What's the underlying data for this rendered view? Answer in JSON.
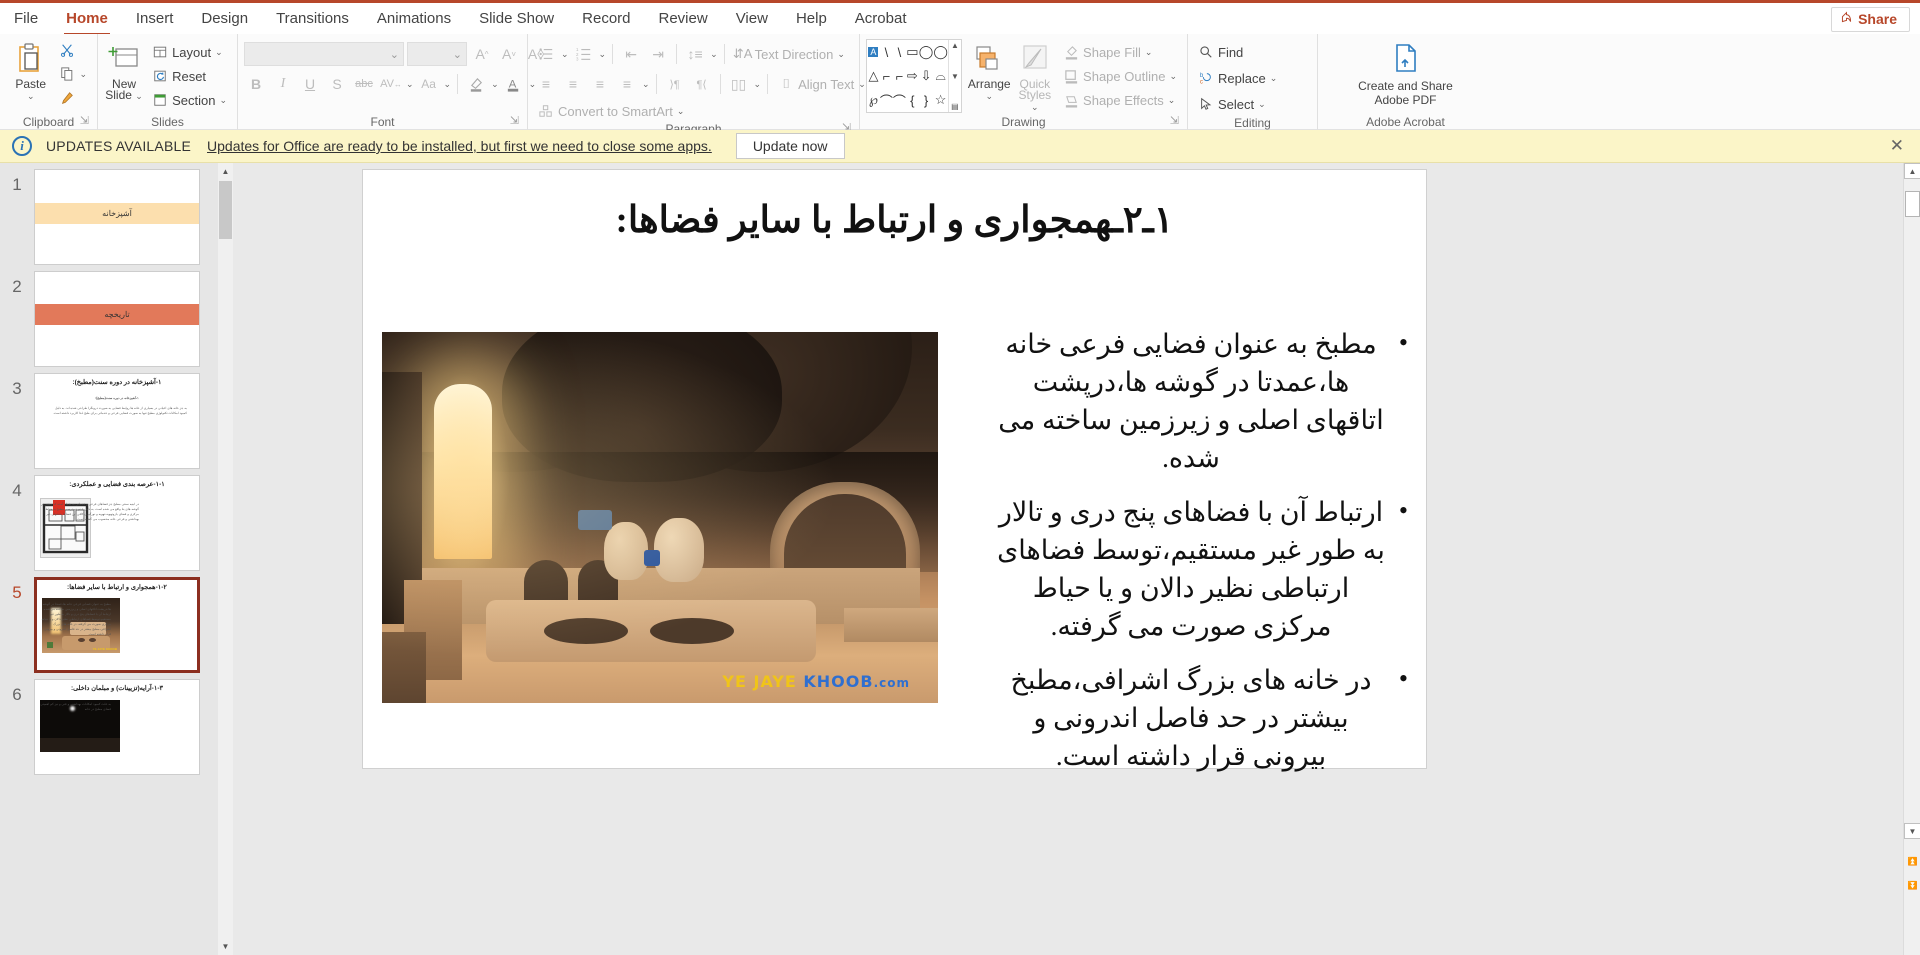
{
  "theme": {
    "accent": "#b7472a",
    "notif_bg": "#fbf5c8",
    "selected_border": "#8c2f20"
  },
  "tabs": [
    {
      "label": "File",
      "active": false
    },
    {
      "label": "Home",
      "active": true
    },
    {
      "label": "Insert",
      "active": false
    },
    {
      "label": "Design",
      "active": false
    },
    {
      "label": "Transitions",
      "active": false
    },
    {
      "label": "Animations",
      "active": false
    },
    {
      "label": "Slide Show",
      "active": false
    },
    {
      "label": "Record",
      "active": false
    },
    {
      "label": "Review",
      "active": false
    },
    {
      "label": "View",
      "active": false
    },
    {
      "label": "Help",
      "active": false
    },
    {
      "label": "Acrobat",
      "active": false
    }
  ],
  "share": {
    "label": "Share"
  },
  "ribbon": {
    "groups": [
      {
        "label": "Clipboard"
      },
      {
        "label": "Slides"
      },
      {
        "label": "Font"
      },
      {
        "label": "Paragraph"
      },
      {
        "label": "Drawing"
      },
      {
        "label": "Editing"
      },
      {
        "label": "Adobe Acrobat"
      }
    ],
    "clipboard": {
      "paste": "Paste",
      "cut": "cut-icon",
      "copy": "copy-icon",
      "format_painter": "format-painter-icon"
    },
    "slides": {
      "new_slide": "New\nSlide",
      "new_slide_line1": "New",
      "new_slide_line2": "Slide",
      "layout": "Layout",
      "reset": "Reset",
      "section": "Section"
    },
    "font": {
      "font_name_value": "",
      "font_size_value": "",
      "grow": "A",
      "shrink": "A",
      "clear_formatting": "clear-formatting-icon",
      "bold": "B",
      "italic": "I",
      "underline": "U",
      "shadow": "S",
      "strikethrough": "abc",
      "char_spacing": "AV",
      "change_case": "Aa",
      "highlight": "text-highlight-icon",
      "font_color": "A"
    },
    "paragraph": {
      "bullets": "bullets-icon",
      "numbering": "numbering-icon",
      "decrease_indent": "decrease-indent-icon",
      "increase_indent": "increase-indent-icon",
      "line_spacing": "line-spacing-icon",
      "align_left": "align-left-icon",
      "align_center": "align-center-icon",
      "align_right": "align-right-icon",
      "justify": "justify-icon",
      "rtl": "rtl-icon",
      "ltr": "ltr-icon",
      "columns": "columns-icon",
      "text_direction": "Text Direction",
      "align_text": "Align Text",
      "convert_to_smartart": "Convert to SmartArt"
    },
    "drawing": {
      "shapes_row1": [
        "A",
        "\\",
        "\\",
        "▭",
        "◯",
        "◯"
      ],
      "shapes_row2": [
        "△",
        "⌐",
        "⌐",
        "⇨",
        "⇩",
        "⌓"
      ],
      "shapes_row3": [
        "℘",
        "⌒",
        "⌒",
        "{",
        "}",
        "☆"
      ],
      "arrange": "Arrange",
      "quick_styles_line1": "Quick",
      "quick_styles_line2": "Styles",
      "shape_fill": "Shape Fill",
      "shape_outline": "Shape Outline",
      "shape_effects": "Shape Effects"
    },
    "editing": {
      "find": "Find",
      "replace": "Replace",
      "select": "Select"
    },
    "acrobat": {
      "create_share_line1": "Create and Share",
      "create_share_line2": "Adobe PDF"
    }
  },
  "notification": {
    "icon": "info-icon",
    "title": "UPDATES AVAILABLE",
    "message": "Updates for Office are ready to be installed, but first we need to close some apps.",
    "button": "Update now",
    "close": "✕"
  },
  "slide_panel": {
    "slides": [
      {
        "number": "1",
        "kind": "banner",
        "banner_text": "آشپزخانه",
        "banner_color": "#fcdfae",
        "selected": false
      },
      {
        "number": "2",
        "kind": "banner",
        "banner_text": "تاریخچه",
        "banner_color": "#e2795a",
        "selected": false
      },
      {
        "number": "3",
        "kind": "text",
        "title": "۱-آشپزخانه در دوره سنت(مطبخ):",
        "subtitle": "۱-آشپزخانه در دوره سنت(مطبخ):",
        "body": "به جز خانه های اعیانی در بسیاری از خانه ها روابط فضایی به صورت درونگرا طراحی شده اند. به دلیل کمبود امکانات تکنولوژی مطبخ تنها به صورت فضایی فرعی و خدماتی برای طبخ غذا کاربرد داشته است.",
        "selected": false
      },
      {
        "number": "4",
        "kind": "plan",
        "title": "۱-۱-عرصه بندی فضایی و عملکردی:",
        "body": "در ابنیه سنتی مطبخ جز فضاهای فرعی و خدماتی به شمار آمده که بیشتر در گوشه های بنا واقع می شده است. به دلیل عدم دسترسی مطبخ به حیاط مرکزی و فضای بازوتهویه،تهویه و نورگیری کافی این فضاها بخشهای غیر بهداشتی و فرعی خانه محسوب می گشته است.",
        "selected": false
      },
      {
        "number": "5",
        "kind": "photo",
        "title": "۱-۲-همجواری و ارتباط با سایر فضاها:",
        "body": "مطبخ به عنوان فضایی فرعی خانه ها،عمدتا در گوشه ها،درپشت اتاقهای اصلی و زیرزمین ساخته می شده. ارتباط آن با فضاهای پنج دری و تالار به طور غیر مستقیم،توسط فضاهای ارتباطی نظیر دالان و یا حیاط مرکزی صورت می گرفته. در خانه های بزرگ اشرافی،مطبخ بیشتر در حد فاصل اندرونی و بیرونی قرار داشته است.",
        "selected": true
      },
      {
        "number": "6",
        "kind": "photo2",
        "title": "۱-۳-آرایه(تزیینات) و مبلمان داخلی:",
        "body": "به علت کمبود امکانات بهداشتی و فنی و نیز کم اهمیتی فضای مطبخ در خانه",
        "selected": false
      }
    ]
  },
  "slide": {
    "title": "۱ـ۲ـهمجواری و ارتباط با سایر فضاها:",
    "bullets": [
      "مطبخ به عنوان فضایی فرعی خانه ها،عمدتا در گوشه ها،درپشت اتاقهای اصلی و زیرزمین ساخته می شده.",
      "ارتباط آن با فضاهای پنج دری و تالار به طور غیر مستقیم،توسط فضاهای ارتباطی نظیر دالان و یا حیاط مرکزی صورت می گرفته.",
      "در خانه های بزرگ اشرافی،مطبخ بیشتر در حد فاصل اندرونی و بیرونی قرار داشته است."
    ],
    "photo": {
      "alt": "traditional-persian-vaulted-kitchen-photo",
      "watermark": {
        "part1": "YE",
        "part2": "JAYE",
        "part3": "KHOOB",
        "part4": ".com"
      }
    }
  },
  "scrollbars": {
    "panel_up": "▲",
    "panel_down": "▼",
    "canvas_up": "▲",
    "canvas_down": "▼",
    "canvas_prev": "▲",
    "canvas_next": "▼"
  }
}
